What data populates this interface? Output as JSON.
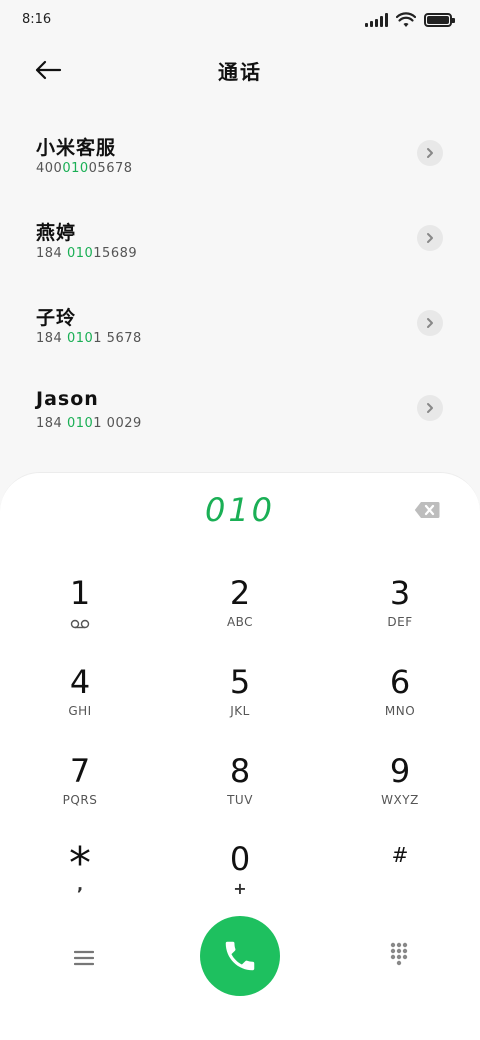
{
  "status_bar": {
    "time": "8:16"
  },
  "header": {
    "title": "通话"
  },
  "contacts": [
    {
      "name": "小米客服",
      "number_parts": [
        "400",
        "010",
        "05678"
      ]
    },
    {
      "name": "燕婷",
      "number_parts": [
        "184 ",
        "010",
        "15689"
      ]
    },
    {
      "name": "子玲",
      "number_parts": [
        "184 ",
        "010",
        "1 5678"
      ]
    },
    {
      "name": "Jason",
      "number_parts": [
        "184 ",
        "010",
        "1 0029"
      ]
    }
  ],
  "dialpad": {
    "entered": "010",
    "keys": [
      {
        "digit": "1",
        "sub": ""
      },
      {
        "digit": "2",
        "sub": "ABC"
      },
      {
        "digit": "3",
        "sub": "DEF"
      },
      {
        "digit": "4",
        "sub": "GHI"
      },
      {
        "digit": "5",
        "sub": "JKL"
      },
      {
        "digit": "6",
        "sub": "MNO"
      },
      {
        "digit": "7",
        "sub": "PQRS"
      },
      {
        "digit": "8",
        "sub": "TUV"
      },
      {
        "digit": "9",
        "sub": "WXYZ"
      },
      {
        "digit": "*",
        "sub": ","
      },
      {
        "digit": "0",
        "sub": "+"
      },
      {
        "digit": "#",
        "sub": ""
      }
    ]
  },
  "colors": {
    "accent": "#1aaf55",
    "call_button": "#1ec05f"
  }
}
